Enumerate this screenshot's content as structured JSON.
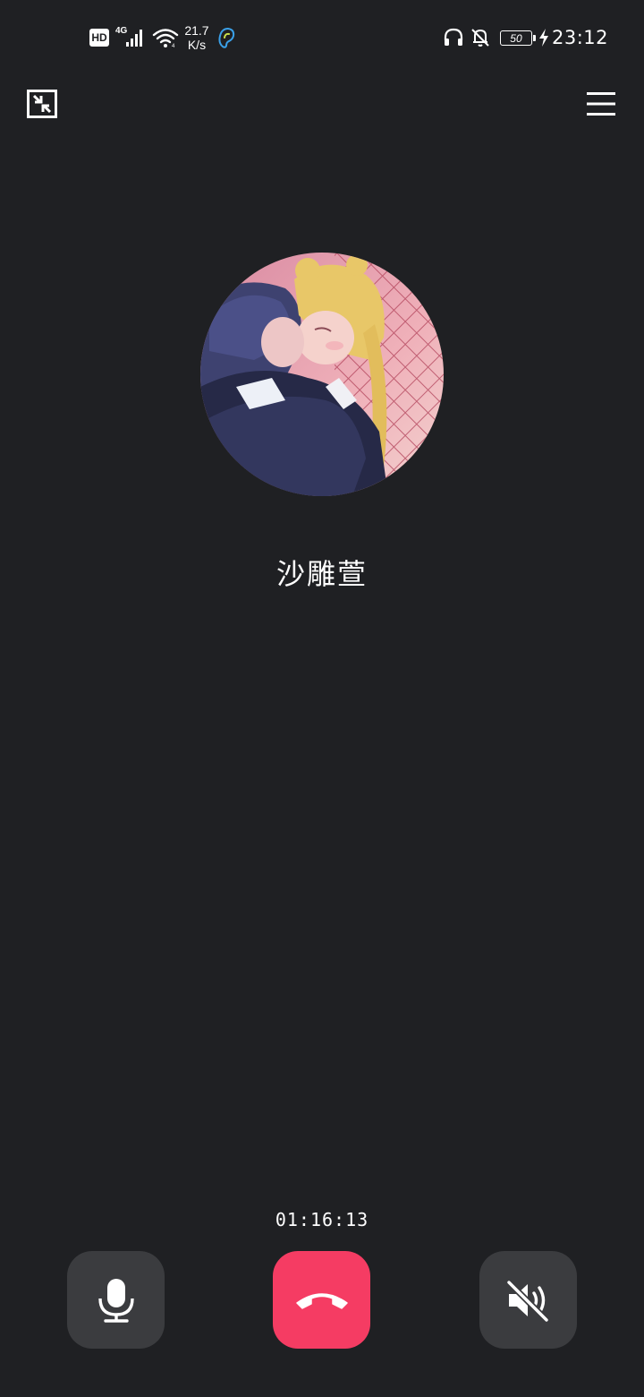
{
  "status_bar": {
    "hd_label": "HD",
    "network_type": "4G",
    "net_speed_value": "21.7",
    "net_speed_unit": "K/s",
    "battery_level": "50",
    "clock": "23:12",
    "left_icons": [
      "hd-badge",
      "signal-icon",
      "wifi-icon",
      "ear-assist-icon"
    ],
    "right_icons": [
      "headphones-icon",
      "bell-off-icon",
      "battery-icon",
      "charging-icon"
    ]
  },
  "top_controls": {
    "minimize_icon": "minimize-window-icon",
    "menu_icon": "hamburger-menu-icon"
  },
  "caller": {
    "name": "沙雕萱",
    "avatar": "contact-avatar-image"
  },
  "call": {
    "timer": "01:16:13",
    "controls": [
      {
        "name": "microphone",
        "icon": "microphone-icon"
      },
      {
        "name": "hang-up",
        "icon": "phone-hangup-icon"
      },
      {
        "name": "speaker",
        "icon": "speaker-muted-icon"
      }
    ]
  },
  "colors": {
    "background": "#1f2023",
    "control_button": "#3b3c3f",
    "hangup_button": "#f53c63",
    "accent_ear_icon": "#3aa0e8"
  }
}
